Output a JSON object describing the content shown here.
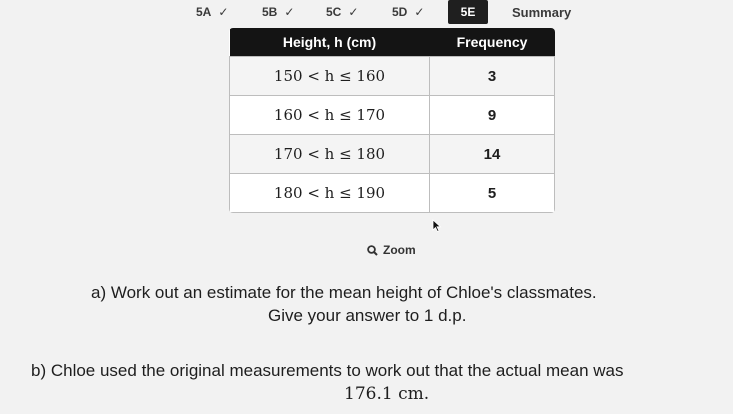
{
  "tabs": [
    {
      "label": "5A",
      "checked": true
    },
    {
      "label": "5B",
      "checked": true
    },
    {
      "label": "5C",
      "checked": true
    },
    {
      "label": "5D",
      "checked": true
    },
    {
      "label": "5E",
      "checked": false,
      "active": true
    },
    {
      "label": "Summary",
      "checked": false
    }
  ],
  "table": {
    "headers": [
      "Height, h (cm)",
      "Frequency"
    ],
    "rows": [
      {
        "range": "150 < h ≤ 160",
        "frequency": "3"
      },
      {
        "range": "160 < h ≤ 170",
        "frequency": "9"
      },
      {
        "range": "170 < h ≤ 180",
        "frequency": "14"
      },
      {
        "range": "180 < h ≤ 190",
        "frequency": "5"
      }
    ]
  },
  "zoom_label": "Zoom",
  "question_a": {
    "line1": "a) Work out an estimate for the mean height of Chloe's classmates.",
    "line2": "Give your answer to 1 d.p."
  },
  "question_b": {
    "line1": "b) Chloe used the original measurements to work out that the actual mean was",
    "line2": "176.1 cm."
  },
  "colors": {
    "header_bg": "#141414",
    "active_tab_bg": "#1f1f1f",
    "page_bg": "#f2f2f2"
  }
}
